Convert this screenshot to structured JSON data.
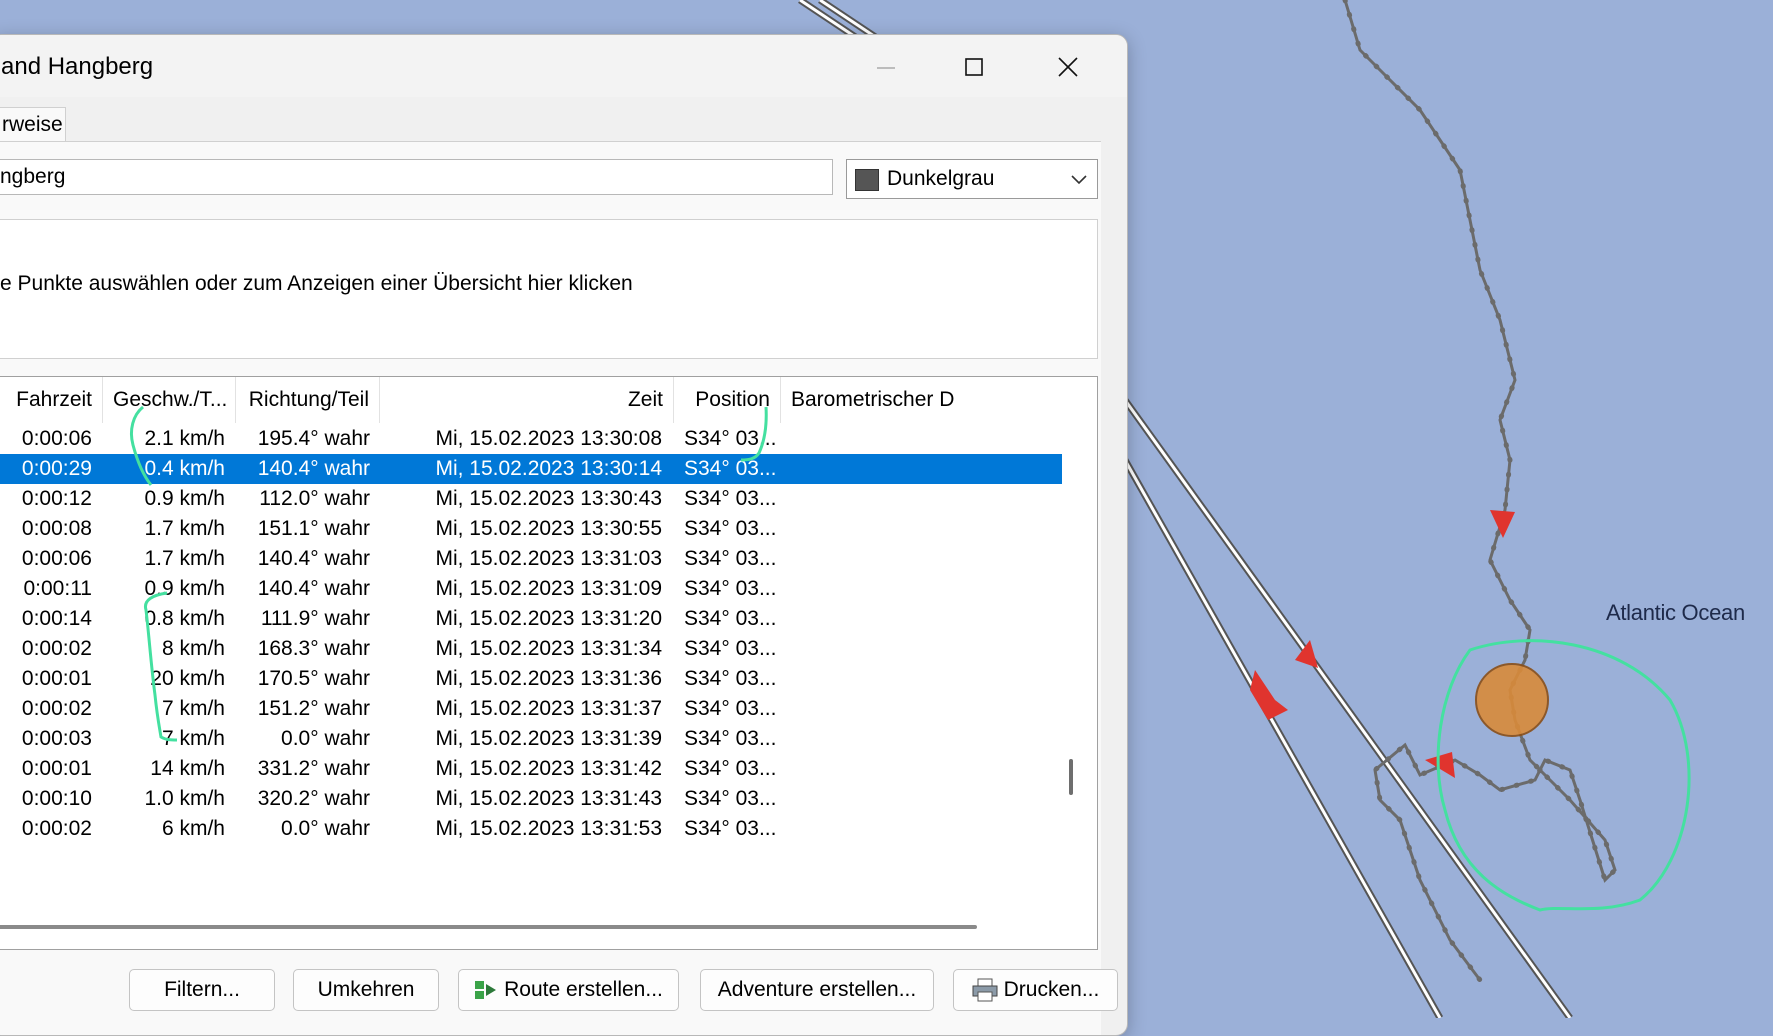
{
  "window": {
    "title": "and Hangberg",
    "minimize_label": "Minimize",
    "maximize_label": "Maximize",
    "close_label": "Close"
  },
  "tabs": [
    {
      "label": "rweise"
    }
  ],
  "name_field": {
    "value": "ngberg"
  },
  "color_select": {
    "value": "Dunkelgrau",
    "swatch_color": "#555555"
  },
  "summary": {
    "text": "e Punkte auswählen oder zum Anzeigen einer Übersicht hier klicken"
  },
  "table": {
    "columns": [
      "Fahrzeit",
      "Geschw./T...",
      "Richtung/Teil",
      "Zeit",
      "Position",
      "Barometrischer D"
    ],
    "rows": [
      {
        "fahrzeit": "0:00:06",
        "geschw": "2.1 km/h",
        "richtung": "195.4° wahr",
        "zeit": "Mi, 15.02.2023 13:30:08",
        "position": "S34° 03..."
      },
      {
        "fahrzeit": "0:00:29",
        "geschw": "0.4 km/h",
        "richtung": "140.4° wahr",
        "zeit": "Mi, 15.02.2023 13:30:14",
        "position": "S34° 03...",
        "selected": true
      },
      {
        "fahrzeit": "0:00:12",
        "geschw": "0.9 km/h",
        "richtung": "112.0° wahr",
        "zeit": "Mi, 15.02.2023 13:30:43",
        "position": "S34° 03..."
      },
      {
        "fahrzeit": "0:00:08",
        "geschw": "1.7 km/h",
        "richtung": "151.1° wahr",
        "zeit": "Mi, 15.02.2023 13:30:55",
        "position": "S34° 03..."
      },
      {
        "fahrzeit": "0:00:06",
        "geschw": "1.7 km/h",
        "richtung": "140.4° wahr",
        "zeit": "Mi, 15.02.2023 13:31:03",
        "position": "S34° 03..."
      },
      {
        "fahrzeit": "0:00:11",
        "geschw": "0.9 km/h",
        "richtung": "140.4° wahr",
        "zeit": "Mi, 15.02.2023 13:31:09",
        "position": "S34° 03..."
      },
      {
        "fahrzeit": "0:00:14",
        "geschw": "0.8 km/h",
        "richtung": "111.9° wahr",
        "zeit": "Mi, 15.02.2023 13:31:20",
        "position": "S34° 03..."
      },
      {
        "fahrzeit": "0:00:02",
        "geschw": "8 km/h",
        "richtung": "168.3° wahr",
        "zeit": "Mi, 15.02.2023 13:31:34",
        "position": "S34° 03..."
      },
      {
        "fahrzeit": "0:00:01",
        "geschw": "20 km/h",
        "richtung": "170.5° wahr",
        "zeit": "Mi, 15.02.2023 13:31:36",
        "position": "S34° 03..."
      },
      {
        "fahrzeit": "0:00:02",
        "geschw": "7 km/h",
        "richtung": "151.2° wahr",
        "zeit": "Mi, 15.02.2023 13:31:37",
        "position": "S34° 03..."
      },
      {
        "fahrzeit": "0:00:03",
        "geschw": "7 km/h",
        "richtung": "0.0° wahr",
        "zeit": "Mi, 15.02.2023 13:31:39",
        "position": "S34° 03..."
      },
      {
        "fahrzeit": "0:00:01",
        "geschw": "14 km/h",
        "richtung": "331.2° wahr",
        "zeit": "Mi, 15.02.2023 13:31:42",
        "position": "S34° 03..."
      },
      {
        "fahrzeit": "0:00:10",
        "geschw": "1.0 km/h",
        "richtung": "320.2° wahr",
        "zeit": "Mi, 15.02.2023 13:31:43",
        "position": "S34° 03..."
      },
      {
        "fahrzeit": "0:00:02",
        "geschw": "6 km/h",
        "richtung": "0.0° wahr",
        "zeit": "Mi, 15.02.2023 13:31:53",
        "position": "S34° 03..."
      }
    ]
  },
  "buttons": {
    "filter": "Filtern...",
    "reverse": "Umkehren",
    "route": "Route erstellen...",
    "adventure": "Adventure erstellen...",
    "print": "Drucken..."
  },
  "map": {
    "label": "Atlantic Ocean",
    "water_color": "#9bb0d8",
    "track_color": "#6b6b6b",
    "marker_color": "#e0342e",
    "annotation_color": "#44e0a0",
    "position_marker_color": "#d98b3a"
  }
}
